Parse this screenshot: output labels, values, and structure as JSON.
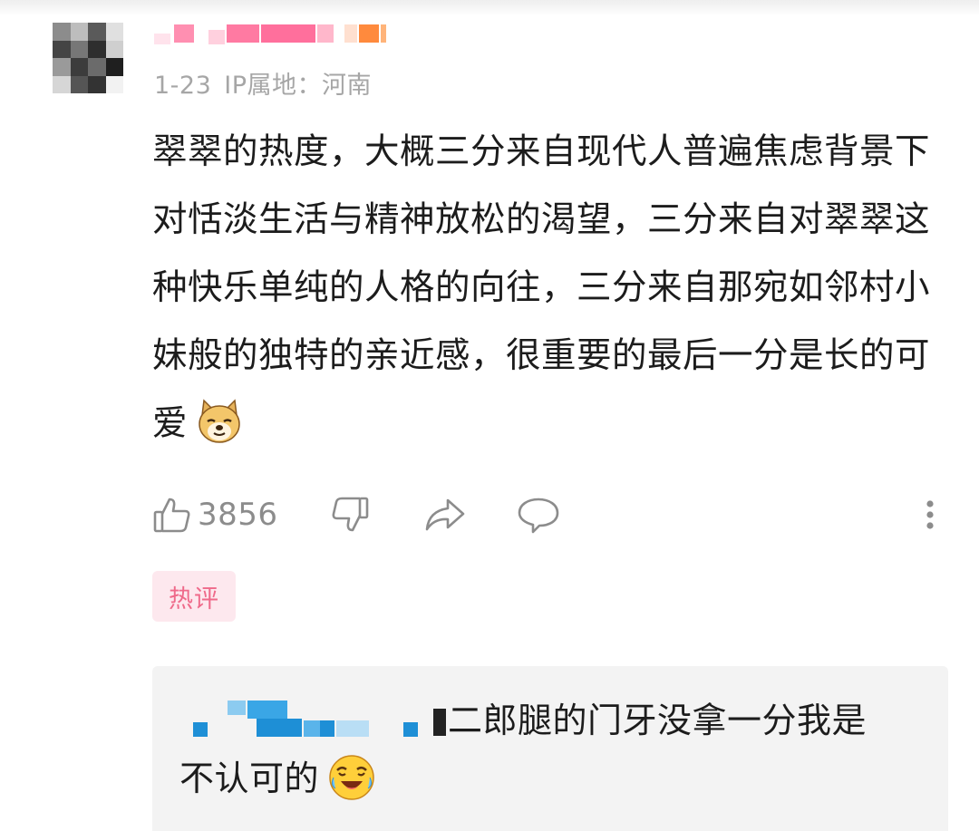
{
  "comment": {
    "date": "1-23",
    "ip_location": "IP属地：河南",
    "text": "翠翠的热度，大概三分来自现代人普遍焦虑背景下对恬淡生活与精神放松的渴望，三分来自对翠翠这种快乐单纯的人格的向往，三分来自那宛如邻村小妹般的独特的亲近感，很重要的最后一分是长的可爱",
    "end_emoji": "doge-emoji",
    "like_count": "3856",
    "tag": "热评"
  },
  "reply": {
    "text_line1": "二郎腿的门牙没拿一分我是",
    "text_line2": "不认可的",
    "end_emoji": "laugh-tears-emoji"
  },
  "colors": {
    "meta_gray": "#a6a6a6",
    "icon_gray": "#8c8c8c",
    "tag_bg": "#fde8ee",
    "tag_text": "#ef6a8a",
    "reply_bg": "#f3f3f3"
  }
}
